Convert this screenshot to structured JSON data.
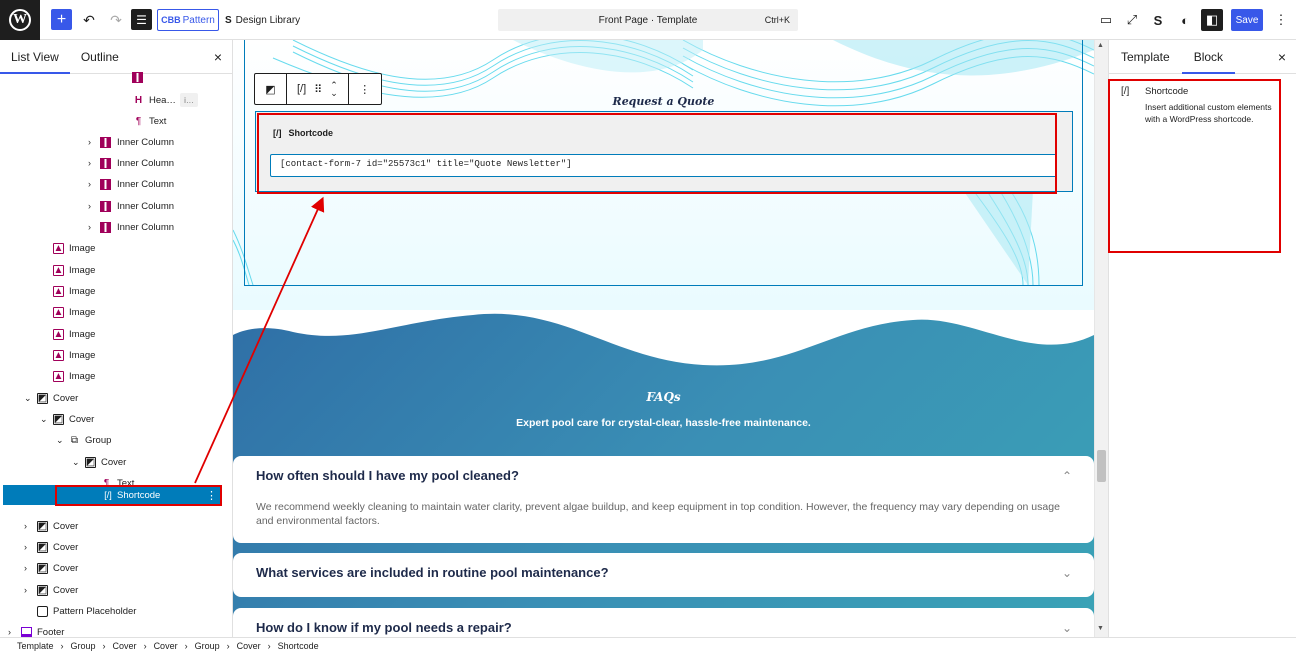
{
  "topbar": {
    "pattern_label": "Pattern",
    "design_library_label": "Design Library",
    "doc_title": "Front Page · Template",
    "shortcut": "Ctrl+K",
    "save_label": "Save"
  },
  "left_panel": {
    "tabs": [
      "List View",
      "Outline"
    ],
    "heading_badge": "i…",
    "tree": [
      {
        "label": "Hea…",
        "icon": "heading"
      },
      {
        "label": "Text",
        "icon": "paragraph"
      },
      {
        "label": "Inner Column",
        "icon": "column"
      },
      {
        "label": "Inner Column",
        "icon": "column"
      },
      {
        "label": "Inner Column",
        "icon": "column"
      },
      {
        "label": "Inner Column",
        "icon": "column"
      },
      {
        "label": "Inner Column",
        "icon": "column"
      },
      {
        "label": "Image",
        "icon": "image"
      },
      {
        "label": "Image",
        "icon": "image"
      },
      {
        "label": "Image",
        "icon": "image"
      },
      {
        "label": "Image",
        "icon": "image"
      },
      {
        "label": "Image",
        "icon": "image"
      },
      {
        "label": "Image",
        "icon": "image"
      },
      {
        "label": "Image",
        "icon": "image"
      },
      {
        "label": "Cover",
        "icon": "cover"
      },
      {
        "label": "Cover",
        "icon": "cover"
      },
      {
        "label": "Group",
        "icon": "group"
      },
      {
        "label": "Cover",
        "icon": "cover"
      },
      {
        "label": "Text",
        "icon": "paragraph"
      },
      {
        "label": "Shortcode",
        "icon": "shortcode"
      },
      {
        "label": "Cover",
        "icon": "cover"
      },
      {
        "label": "Cover",
        "icon": "cover"
      },
      {
        "label": "Cover",
        "icon": "cover"
      },
      {
        "label": "Cover",
        "icon": "cover"
      },
      {
        "label": "Pattern Placeholder",
        "icon": "placeholder"
      },
      {
        "label": "Footer",
        "icon": "footer"
      }
    ]
  },
  "canvas": {
    "request_heading": "Request a Quote",
    "shortcode_block_title": "Shortcode",
    "shortcode_value": "[contact-form-7 id=\"25573c1\" title=\"Quote Newsletter\"]",
    "faq_title": "FAQs",
    "faq_subtitle": "Expert pool care for crystal-clear, hassle-free maintenance.",
    "faqs": [
      {
        "question": "How often should I have my pool cleaned?",
        "answer": "We recommend weekly cleaning to maintain water clarity, prevent algae buildup, and keep equipment in top condition. However, the frequency may vary depending on usage and environmental factors."
      },
      {
        "question": "What services are included in routine pool maintenance?",
        "answer": ""
      },
      {
        "question": "How do I know if my pool needs a repair?",
        "answer": ""
      }
    ]
  },
  "right_panel": {
    "tabs": [
      "Template",
      "Block"
    ],
    "block_name": "Shortcode",
    "block_description": "Insert additional custom elements with a WordPress shortcode."
  },
  "breadcrumbs": [
    "Template",
    "Group",
    "Cover",
    "Cover",
    "Group",
    "Cover",
    "Shortcode"
  ],
  "colors": {
    "accent": "#3858e9",
    "selection": "#007cba",
    "highlight": "#e00000"
  }
}
